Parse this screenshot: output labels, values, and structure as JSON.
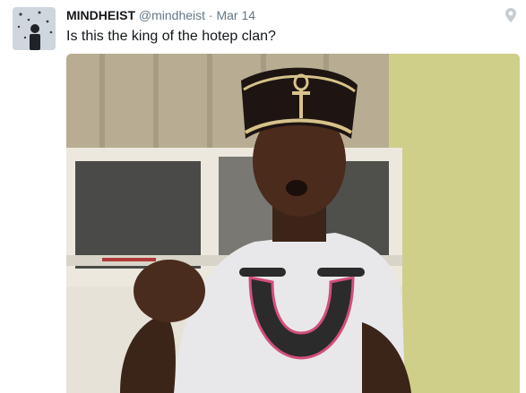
{
  "tweet": {
    "name": "MINDHEIST",
    "handle": "@mindheist",
    "separator": "·",
    "time": "Mar 14",
    "text": "Is this the king of the hotep clan?"
  },
  "icons": {
    "avatar": "avatar-image",
    "location": "location-pin-icon"
  },
  "colors": {
    "text": "#14171a",
    "secondary": "#657786",
    "wall": "#c7c39a"
  }
}
